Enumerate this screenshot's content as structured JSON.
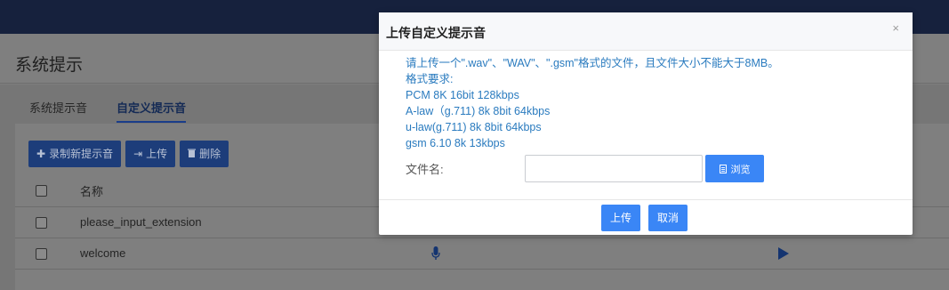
{
  "page": {
    "title": "系统提示",
    "tabs": [
      {
        "label": "系统提示音"
      },
      {
        "label": "自定义提示音"
      }
    ],
    "toolbar": {
      "record_label": "录制新提示音",
      "upload_label": "上传",
      "delete_label": "删除"
    },
    "table": {
      "header_name": "名称",
      "rows": [
        {
          "name": "please_input_extension"
        },
        {
          "name": "welcome"
        }
      ]
    }
  },
  "modal": {
    "title": "上传自定义提示音",
    "close": "×",
    "notes": [
      "请上传一个\".wav\"、\"WAV\"、\".gsm\"格式的文件，且文件大小不能大于8MB。",
      "格式要求:",
      "PCM 8K 16bit 128kbps",
      "A-law（g.711) 8k 8bit 64kbps",
      "u-law(g.711) 8k 8bit 64kbps",
      "gsm 6.10 8k 13kbps"
    ],
    "file_label": "文件名:",
    "file_value": "",
    "browse_label": "浏览",
    "upload_label": "上传",
    "cancel_label": "取消"
  },
  "colors": {
    "accent": "#3a86f6",
    "topbar": "#16213d",
    "note_text": "#2a7bbf"
  },
  "icons": [
    "plus-icon",
    "sign-in-icon",
    "trash-icon",
    "microphone-icon",
    "play-icon",
    "file-icon",
    "close-icon"
  ]
}
